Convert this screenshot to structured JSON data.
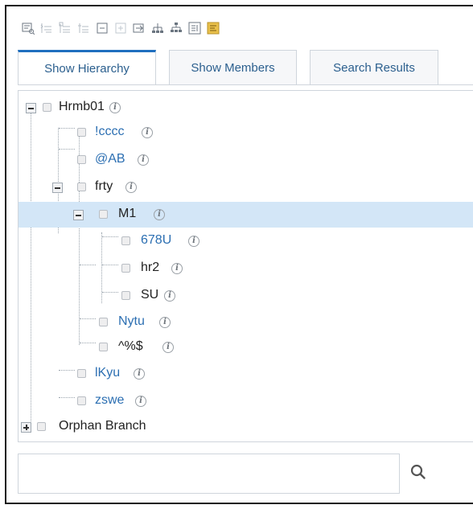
{
  "toolbar": {
    "buttons": [
      {
        "name": "preview-tree-icon"
      },
      {
        "name": "indent-below-icon"
      },
      {
        "name": "add-sibling-icon"
      },
      {
        "name": "add-child-icon"
      },
      {
        "name": "collapse-icon"
      },
      {
        "name": "expand-icon"
      },
      {
        "name": "move-icon"
      },
      {
        "name": "hierarchy-icon"
      },
      {
        "name": "org-chart-icon"
      },
      {
        "name": "list-view-icon"
      },
      {
        "name": "properties-icon"
      }
    ]
  },
  "tabs": [
    {
      "label": "Show Hierarchy",
      "active": true
    },
    {
      "label": "Show Members",
      "active": false
    },
    {
      "label": "Search Results",
      "active": false
    }
  ],
  "tree": {
    "root_label": "Hrmb01",
    "items": {
      "cccc": "!cccc",
      "ab": "@AB",
      "frty": "frty",
      "m1": "M1",
      "u678": "678U",
      "hr2": "hr2",
      "su": "SU",
      "nytu": "Nytu",
      "sym": "^%$",
      "lkyu": "lKyu",
      "zswe": "zswe"
    },
    "orphan_label": "Orphan Branch",
    "info_glyph": "i"
  },
  "search": {
    "value": "",
    "placeholder": ""
  },
  "colors": {
    "accent": "#1f6fbf",
    "link_text": "#2c6fb2",
    "selection": "#d3e6f7"
  }
}
